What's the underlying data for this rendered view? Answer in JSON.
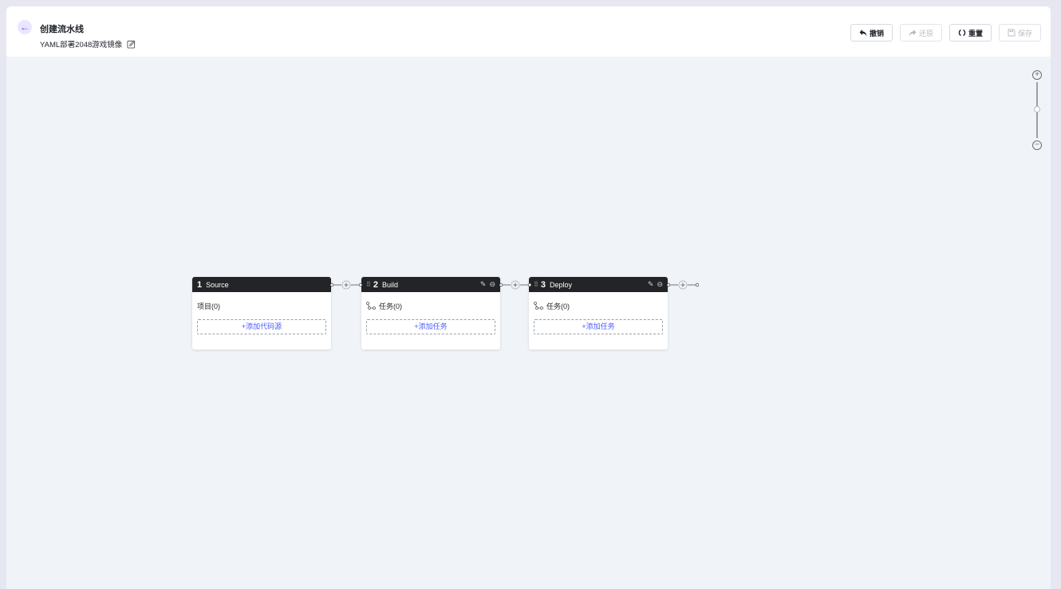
{
  "header": {
    "title": "创建流水线",
    "subtitle": "YAML部署2048游戏镜像",
    "back_icon": "←"
  },
  "toolbar": {
    "undo": "撤销",
    "redo": "还原",
    "reset": "重置",
    "save": "保存"
  },
  "zoom": {
    "in": "+",
    "out": "−"
  },
  "stages": [
    {
      "num": "1",
      "name": "Source",
      "info": "项目(0)",
      "add": "+添加代码源"
    },
    {
      "num": "2",
      "name": "Build",
      "info": "任务(0)",
      "add": "+添加任务"
    },
    {
      "num": "3",
      "name": "Deploy",
      "info": "任务(0)",
      "add": "+添加任务"
    }
  ],
  "colors": {
    "accent": "#5b3cf0",
    "link": "#4b5bfa",
    "stage_header": "#232427",
    "canvas": "#f0f3f7"
  }
}
